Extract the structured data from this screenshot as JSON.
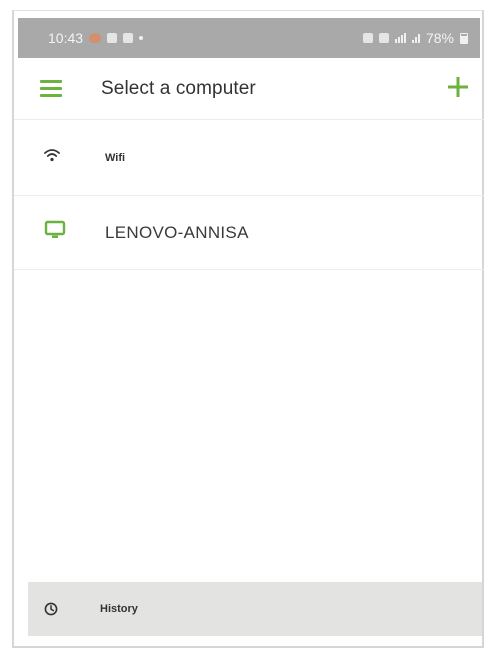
{
  "status_bar": {
    "time": "10:43",
    "battery": "78%"
  },
  "app_bar": {
    "title": "Select a computer",
    "menu_icon": "hamburger-menu-icon",
    "add_icon": "plus-icon"
  },
  "network": {
    "label": "Wifi",
    "icon": "wifi-icon"
  },
  "computers": [
    {
      "name": "LENOVO-ANNISA",
      "icon": "monitor-icon"
    }
  ],
  "footer": {
    "history_label": "History",
    "history_icon": "clock-icon"
  },
  "colors": {
    "accent": "#6bb23f",
    "status_bar": "#a9a9a9",
    "footer_bg": "#e3e4e2",
    "text": "#333333"
  }
}
